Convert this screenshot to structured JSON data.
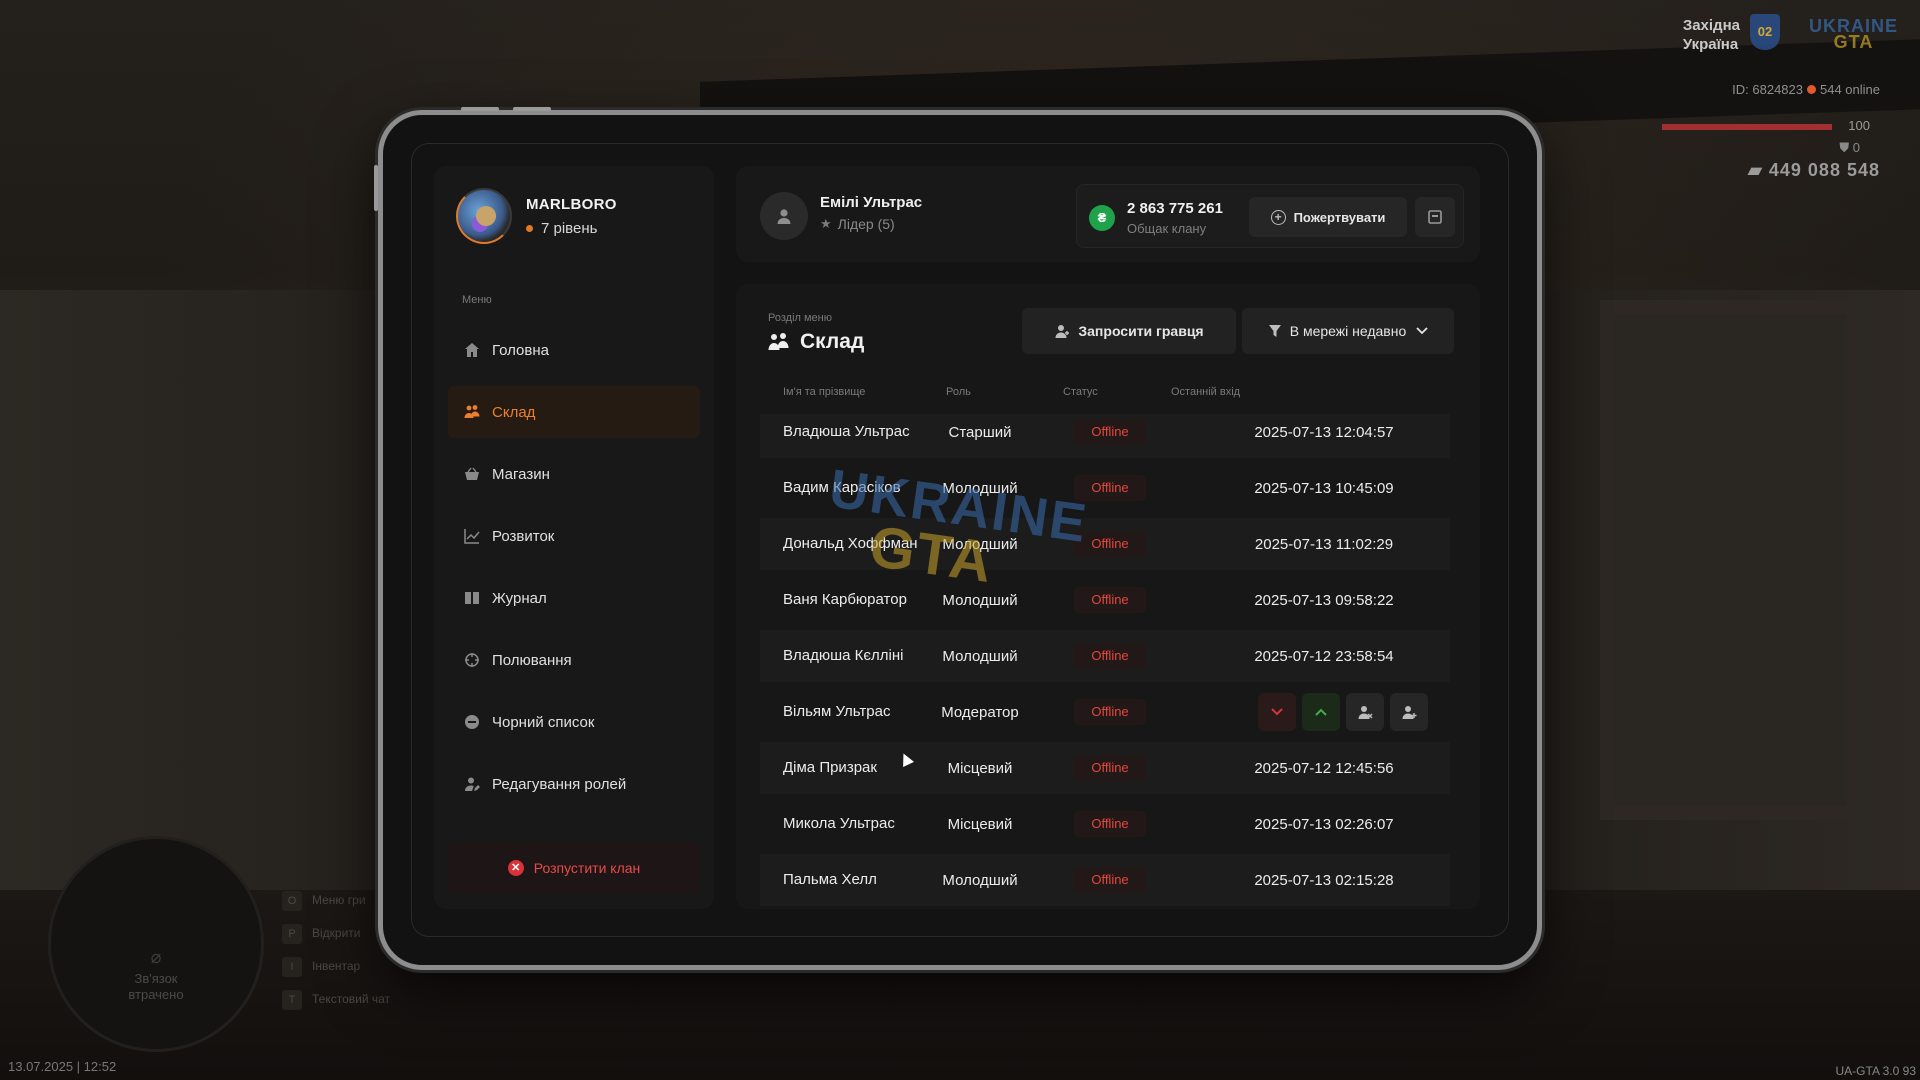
{
  "hud": {
    "region_line1": "Західна",
    "region_line2": "Україна",
    "region_badge": "02",
    "brand_line1": "UKRAINE",
    "brand_line2": "GTA",
    "player_id": "ID: 6824823",
    "online": "544 online",
    "health": "100",
    "health_fraction": 1.0,
    "armor": "0",
    "money": "449 088 548",
    "minimap_lost_line1": "Зв'язок",
    "minimap_lost_line2": "втрачено",
    "keys": [
      {
        "key": "O",
        "label": "Меню гри"
      },
      {
        "key": "P",
        "label": "Відкрити"
      },
      {
        "key": "I",
        "label": "Інвентар"
      },
      {
        "key": "T",
        "label": "Текстовий чат"
      }
    ],
    "datetime": "13.07.2025 | 12:52",
    "version": "UA-GTA 3.0",
    "version_suffix": "93"
  },
  "clan": {
    "name": "MARLBORO",
    "level": "7 рівень"
  },
  "sidebar": {
    "menu_caption": "Меню",
    "items": [
      {
        "label": "Головна",
        "icon": "home-icon"
      },
      {
        "label": "Склад",
        "icon": "people-icon",
        "active": true
      },
      {
        "label": "Магазин",
        "icon": "basket-icon"
      },
      {
        "label": "Розвиток",
        "icon": "chart-icon"
      },
      {
        "label": "Журнал",
        "icon": "book-icon"
      },
      {
        "label": "Полювання",
        "icon": "crosshair-icon"
      },
      {
        "label": "Чорний список",
        "icon": "block-icon"
      },
      {
        "label": "Редагування ролей",
        "icon": "user-edit-icon"
      }
    ],
    "disband_label": "Розпустити клан"
  },
  "user": {
    "name": "Емілі Ультрас",
    "role": "Лідер (5)"
  },
  "treasury": {
    "currency_symbol": "₴",
    "amount": "2 863 775 261",
    "label": "Общак клану",
    "donate_label": "Пожертвувати"
  },
  "section": {
    "caption": "Розділ меню",
    "title": "Склад",
    "invite_label": "Запросити гравця",
    "filter_label": "В мережі недавно"
  },
  "table": {
    "headers": [
      "Ім'я та прізвище",
      "Роль",
      "Статус",
      "Останній вхід"
    ],
    "rows": [
      {
        "name": "Владюша Ультрас",
        "role": "Старший",
        "status": "Offline",
        "last": "2025-07-13 12:04:57"
      },
      {
        "name": "Вадим Карасіков",
        "role": "Молодший",
        "status": "Offline",
        "last": "2025-07-13 10:45:09"
      },
      {
        "name": "Дональд Хоффман",
        "role": "Молодший",
        "status": "Offline",
        "last": "2025-07-13 11:02:29"
      },
      {
        "name": "Ваня Карбюратор",
        "role": "Молодший",
        "status": "Offline",
        "last": "2025-07-13 09:58:22"
      },
      {
        "name": "Владюша Кєлліні",
        "role": "Молодший",
        "status": "Offline",
        "last": "2025-07-12 23:58:54"
      },
      {
        "name": "Вільям Ультрас",
        "role": "Модератор",
        "status": "Offline",
        "last": ""
      },
      {
        "name": "Діма Призрак",
        "role": "Місцевий",
        "status": "Offline",
        "last": "2025-07-12 12:45:56"
      },
      {
        "name": "Микола Ультрас",
        "role": "Місцевий",
        "status": "Offline",
        "last": "2025-07-13 02:26:07"
      },
      {
        "name": "Пальма Хелл",
        "role": "Молодший",
        "status": "Offline",
        "last": "2025-07-13 02:15:28"
      }
    ]
  },
  "watermark": {
    "line1": "UKRAINE",
    "line2": "GTA"
  },
  "colors": {
    "accent": "#ec7e2d",
    "offline": "#e4473c",
    "treasury_coin": "#1fa34a",
    "danger": "#d6333a"
  }
}
